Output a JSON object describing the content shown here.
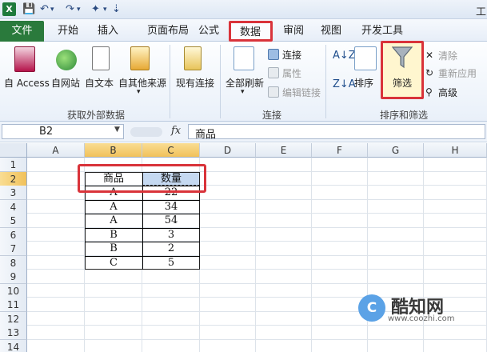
{
  "titlebar": {
    "app_logo": "X",
    "title_partial": "工",
    "icons": [
      "save-icon",
      "undo-icon",
      "redo-icon",
      "wand-icon",
      "customize-icon"
    ]
  },
  "tabs": {
    "file": "文件",
    "items": [
      "开始",
      "插入",
      "页面布局",
      "公式",
      "数据",
      "审阅",
      "视图",
      "开发工具"
    ],
    "active": "数据"
  },
  "ribbon": {
    "get_external": {
      "group_label": "获取外部数据",
      "buttons": [
        "自 Access",
        "自网站",
        "自文本",
        "自其他来源",
        "现有连接"
      ]
    },
    "connections": {
      "group_label": "连接",
      "refresh": "全部刷新",
      "items": [
        "连接",
        "属性",
        "编辑链接"
      ]
    },
    "sort_filter": {
      "group_label": "排序和筛选",
      "sort": "排序",
      "filter": "筛选",
      "items": [
        "清除",
        "重新应用",
        "高级"
      ]
    }
  },
  "formula_bar": {
    "name_box": "B2",
    "fx": "fx",
    "content": "商品"
  },
  "grid": {
    "columns": [
      "A",
      "B",
      "C",
      "D",
      "E",
      "F",
      "G",
      "H"
    ],
    "rows": [
      "1",
      "2",
      "3",
      "4",
      "5",
      "6",
      "7",
      "8",
      "9",
      "10",
      "11",
      "12",
      "13",
      "14"
    ],
    "selected_cell": "B2",
    "table": {
      "headers": [
        "商品",
        "数量"
      ],
      "rows": [
        [
          "A",
          "22"
        ],
        [
          "A",
          "34"
        ],
        [
          "A",
          "54"
        ],
        [
          "B",
          "3"
        ],
        [
          "B",
          "2"
        ],
        [
          "C",
          "5"
        ]
      ]
    }
  },
  "watermark": {
    "logo": "C",
    "name": "酷知网",
    "url": "www.coozhi.com"
  },
  "colors": {
    "file_tab": "#2a7a3c",
    "highlight": "#d9333a",
    "selected_header": "#f1c15a"
  }
}
